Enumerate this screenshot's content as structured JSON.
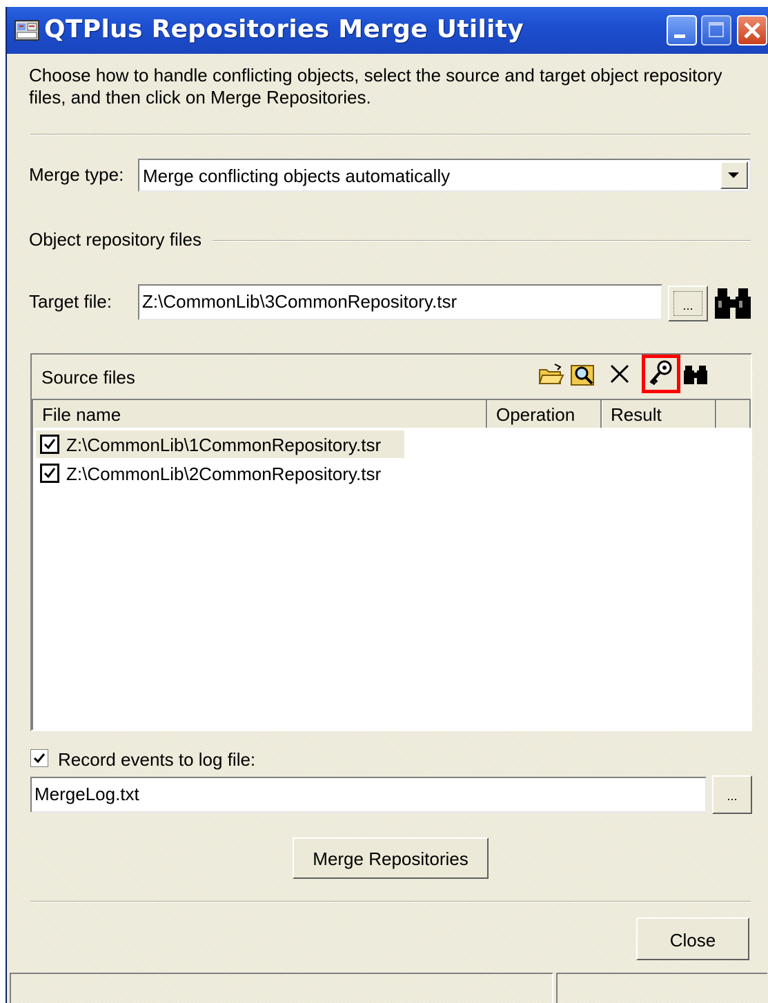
{
  "window": {
    "title": "QTPlus Repositories Merge Utility",
    "icon": "app-icon",
    "controls": [
      "minimize-icon",
      "maximize-icon",
      "close-icon"
    ],
    "title_color": "#1c4fd0"
  },
  "intro_text_line1": "Choose how to handle conflicting objects, select the source and target object repository",
  "intro_text_line2": "files, and then click on Merge Repositories.",
  "merge_type": {
    "label": "Merge type:",
    "selected": "Merge conflicting objects automatically"
  },
  "object_repository_group": "Object repository files",
  "target_file": {
    "label": "Target file:",
    "value": "Z:\\CommonLib\\3CommonRepository.tsr",
    "browse_label": "..."
  },
  "source_files": {
    "label": "Source files",
    "toolbar": [
      "open-folder-icon",
      "search-folder-icon",
      "delete-icon",
      "key-icon",
      "binoculars-icon"
    ],
    "highlighted_tool": "key-icon",
    "highlight_color": "#ff0000",
    "columns": [
      "File name",
      "Operation",
      "Result"
    ],
    "rows": [
      {
        "checked": true,
        "file": "Z:\\CommonLib\\1CommonRepository.tsr",
        "operation": "",
        "result": ""
      },
      {
        "checked": true,
        "file": "Z:\\CommonLib\\2CommonRepository.tsr",
        "operation": "",
        "result": ""
      }
    ]
  },
  "log": {
    "checked": true,
    "label": "Record events to log file:",
    "value": "MergeLog.txt",
    "browse_label": "..."
  },
  "buttons": {
    "merge": "Merge Repositories",
    "close": "Close"
  }
}
